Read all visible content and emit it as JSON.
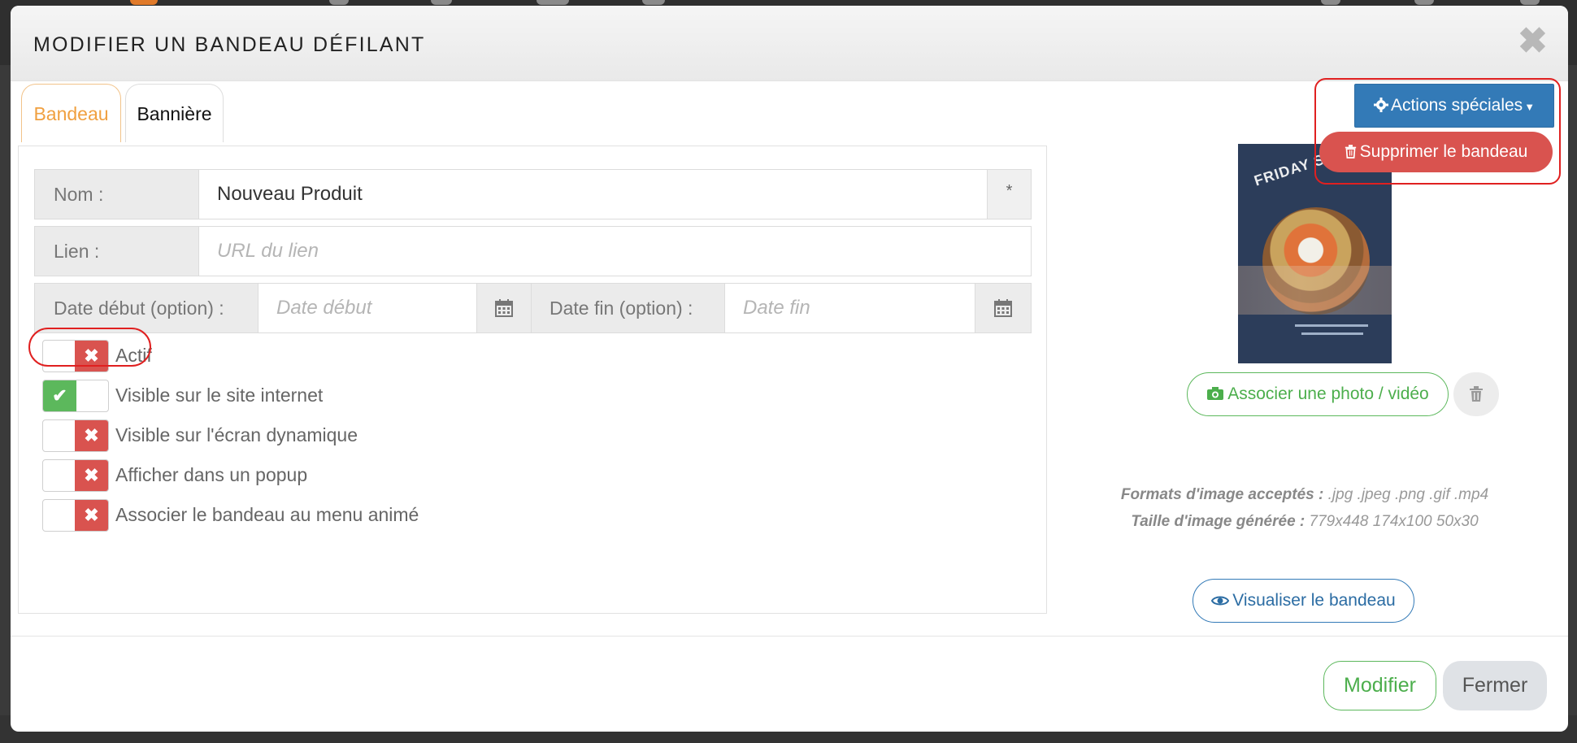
{
  "modal": {
    "title": "MODIFIER UN BANDEAU DÉFILANT",
    "close_glyph": "✖"
  },
  "tabs": [
    {
      "label": "Bandeau",
      "active": true
    },
    {
      "label": "Bannière",
      "active": false
    }
  ],
  "form": {
    "name_label": "Nom :",
    "name_value": "Nouveau Produit",
    "name_required": "*",
    "link_label": "Lien :",
    "link_placeholder": "URL du lien",
    "start_date_label": "Date début (option) :",
    "start_date_placeholder": "Date début",
    "end_date_label": "Date fin (option) :",
    "end_date_placeholder": "Date fin"
  },
  "toggles": [
    {
      "label": "Actif",
      "on": false
    },
    {
      "label": "Visible sur le site internet",
      "on": true
    },
    {
      "label": "Visible sur l'écran dynamique",
      "on": false
    },
    {
      "label": "Afficher dans un popup",
      "on": false
    },
    {
      "label": "Associer le bandeau au menu animé",
      "on": false
    }
  ],
  "actions": {
    "special_label": "Actions spéciales",
    "delete_label": "Supprimer le bandeau"
  },
  "media": {
    "poster_text": "FRIDAY SA",
    "associate_label": "Associer une photo / vidéo",
    "formats_label": "Formats d'image acceptés :",
    "formats_value": ".jpg .jpeg .png .gif .mp4",
    "size_label": "Taille d'image générée :",
    "size_value": "779x448 174x100 50x30",
    "preview_label": "Visualiser le bandeau"
  },
  "footer": {
    "modify_label": "Modifier",
    "close_label": "Fermer"
  },
  "colors": {
    "tab_active": "#f0a040",
    "primary": "#337ab7",
    "danger": "#d9534f",
    "success": "#5cb85c",
    "highlight": "#e02020"
  },
  "icons": [
    "close-icon",
    "calendar-icon",
    "x-icon",
    "check-icon",
    "gear-icon",
    "caret-down-icon",
    "trash-icon",
    "camera-icon",
    "eye-icon"
  ]
}
